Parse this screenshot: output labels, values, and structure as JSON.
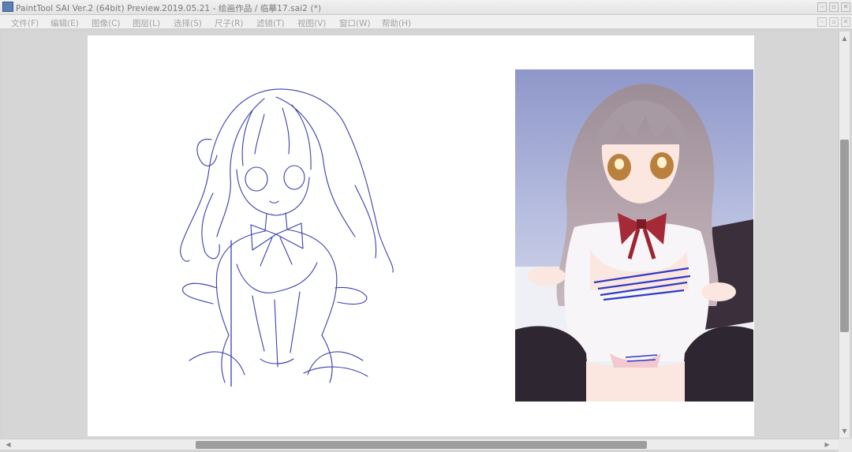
{
  "window": {
    "title": "PaintTool SAI Ver.2 (64bit) Preview.2019.05.21 - 绘画作品 / 临摹17.sai2 (*)",
    "controls": {
      "minimize": "–",
      "maximize": "▫",
      "close": "✕"
    },
    "doc_controls": {
      "minimize": "–",
      "restore": "▫",
      "close": "✕"
    }
  },
  "menu": [
    {
      "label": "文件(F)"
    },
    {
      "label": "编辑(E)"
    },
    {
      "label": "图像(C)"
    },
    {
      "label": "图层(L)"
    },
    {
      "label": "选择(S)"
    },
    {
      "label": "尺子(R)"
    },
    {
      "label": "滤镜(T)"
    },
    {
      "label": "视图(V)"
    },
    {
      "label": "窗口(W)"
    },
    {
      "label": "帮助(H)"
    }
  ],
  "scroll": {
    "up_arrow": "▲",
    "down_arrow": "▼",
    "left_arrow": "◀",
    "right_arrow": "▶"
  },
  "icons": {
    "app": "paint-tool-sai-icon"
  },
  "colors": {
    "sketch_line": "#3a3fb0",
    "canvas": "#ffffff",
    "workspace": "#d6d6d6"
  }
}
